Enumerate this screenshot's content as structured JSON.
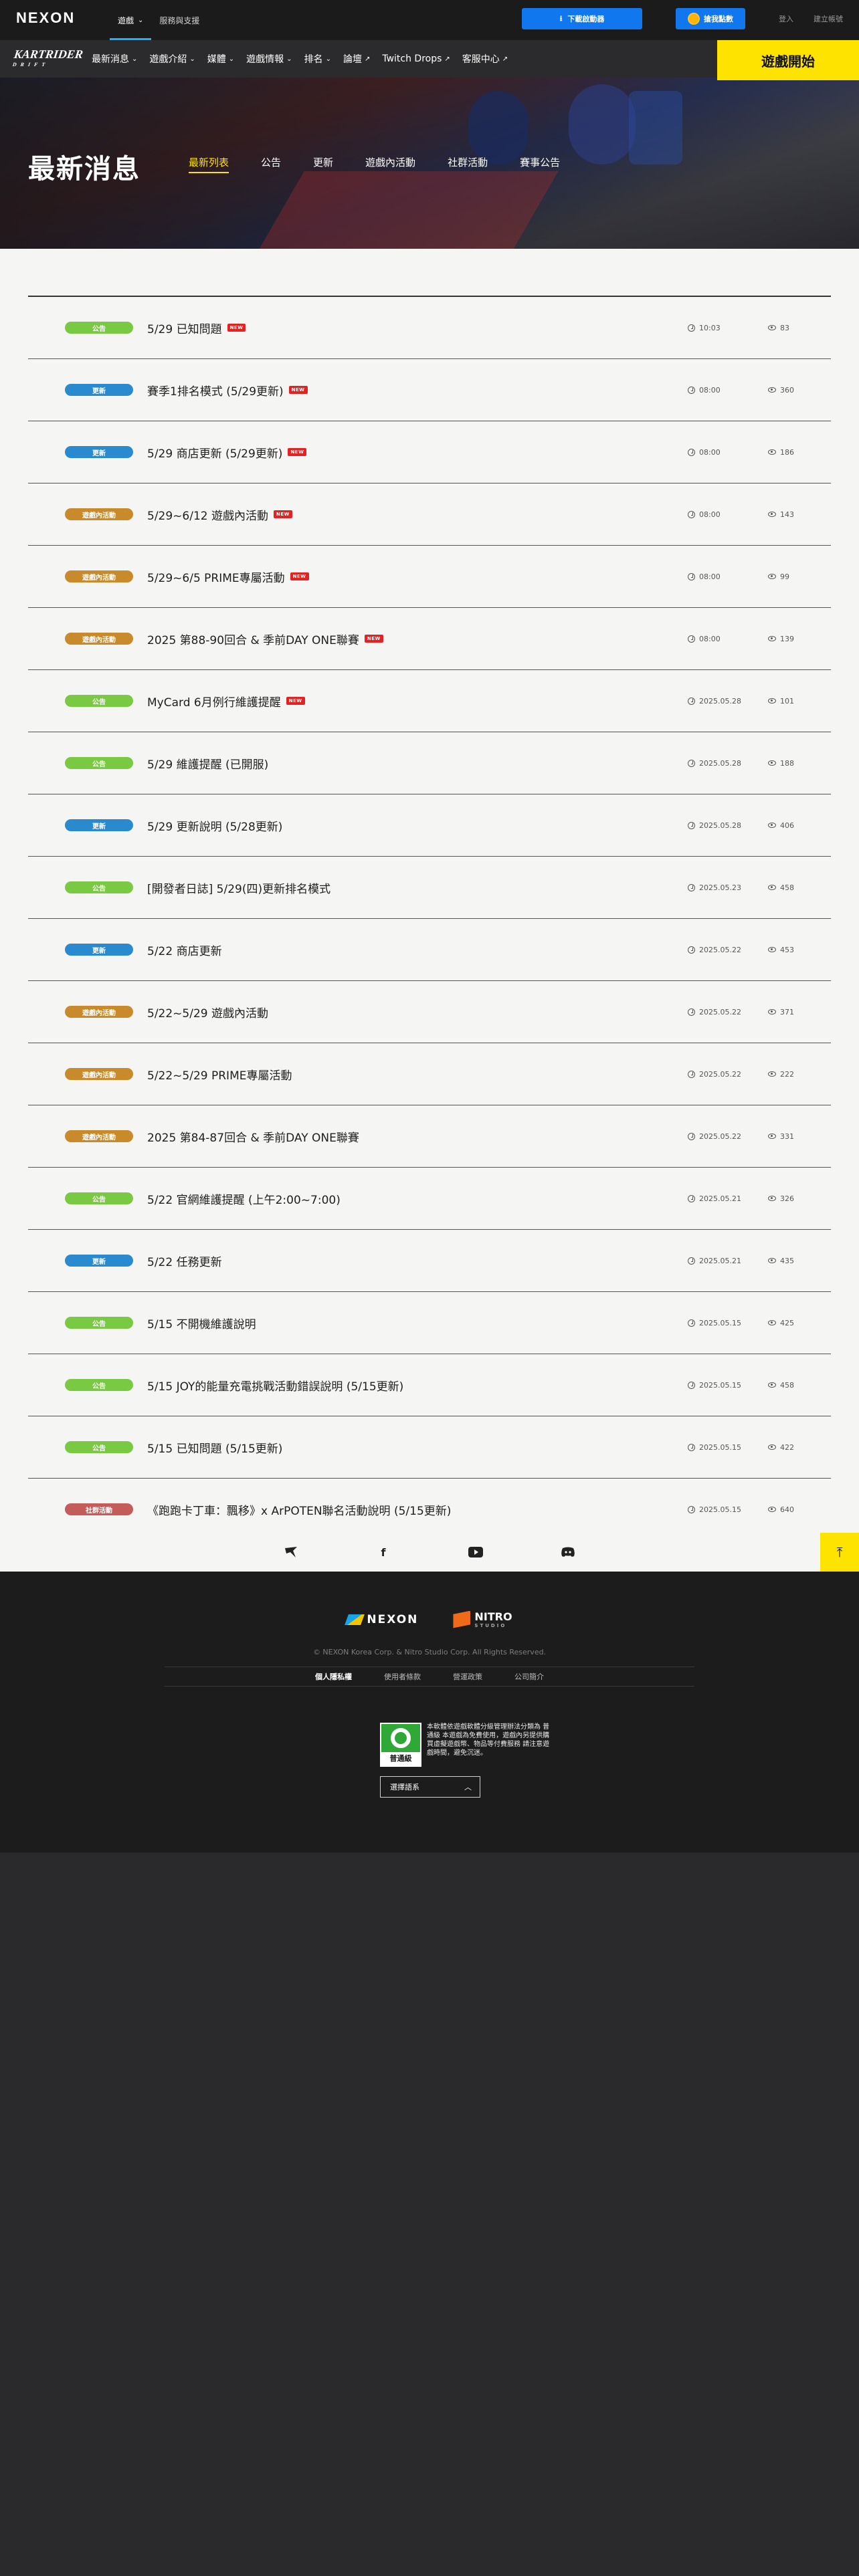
{
  "topbar": {
    "logo": "NEXON",
    "nav": [
      {
        "label": "遊戲",
        "caret": "⌄",
        "active": true
      },
      {
        "label": "服務與支援",
        "caret": "",
        "active": false
      }
    ],
    "download_label": "下載啟動器",
    "points_label": "搶我點數",
    "login_label": "登入",
    "register_label": "建立帳號"
  },
  "gamenav": {
    "logo": "KARTRIDER",
    "logo_sub": "DRIFT",
    "items": [
      {
        "label": "最新消息",
        "suffix": "⌄"
      },
      {
        "label": "遊戲介紹",
        "suffix": "⌄"
      },
      {
        "label": "媒體",
        "suffix": "⌄"
      },
      {
        "label": "遊戲情報",
        "suffix": "⌄"
      },
      {
        "label": "排名",
        "suffix": "⌄"
      },
      {
        "label": "論壇",
        "suffix": "↗"
      },
      {
        "label": "Twitch Drops",
        "suffix": "↗"
      },
      {
        "label": "客服中心",
        "suffix": "↗"
      }
    ],
    "start_label": "遊戲開始"
  },
  "banner": {
    "title": "最新消息",
    "tabs": [
      "最新列表",
      "公告",
      "更新",
      "遊戲內活動",
      "社群活動",
      "賽事公告"
    ],
    "active_tab": 0
  },
  "category_colors": {
    "公告": "#7ac943",
    "更新": "#2a8ad0",
    "遊戲內活動": "#c88a2a",
    "社群活動": "#c55c5c"
  },
  "news": [
    {
      "category": "公告",
      "title": "5/29 已知問題",
      "new": true,
      "date": "10:03",
      "views": "83"
    },
    {
      "category": "更新",
      "title": "賽季1排名模式 (5/29更新)",
      "new": true,
      "date": "08:00",
      "views": "360"
    },
    {
      "category": "更新",
      "title": "5/29 商店更新 (5/29更新)",
      "new": true,
      "date": "08:00",
      "views": "186"
    },
    {
      "category": "遊戲內活動",
      "title": "5/29~6/12 遊戲內活動",
      "new": true,
      "date": "08:00",
      "views": "143"
    },
    {
      "category": "遊戲內活動",
      "title": "5/29~6/5 PRIME專屬活動",
      "new": true,
      "date": "08:00",
      "views": "99"
    },
    {
      "category": "遊戲內活動",
      "title": "2025 第88-90回合 & 季前DAY ONE聯賽",
      "new": true,
      "date": "08:00",
      "views": "139"
    },
    {
      "category": "公告",
      "title": "MyCard 6月例行維護提醒",
      "new": true,
      "date": "2025.05.28",
      "views": "101"
    },
    {
      "category": "公告",
      "title": "5/29 維護提醒 (已開服)",
      "new": false,
      "date": "2025.05.28",
      "views": "188"
    },
    {
      "category": "更新",
      "title": "5/29 更新說明 (5/28更新)",
      "new": false,
      "date": "2025.05.28",
      "views": "406"
    },
    {
      "category": "公告",
      "title": "[開發者日誌] 5/29(四)更新排名模式",
      "new": false,
      "date": "2025.05.23",
      "views": "458"
    },
    {
      "category": "更新",
      "title": "5/22 商店更新",
      "new": false,
      "date": "2025.05.22",
      "views": "453"
    },
    {
      "category": "遊戲內活動",
      "title": "5/22~5/29 遊戲內活動",
      "new": false,
      "date": "2025.05.22",
      "views": "371"
    },
    {
      "category": "遊戲內活動",
      "title": "5/22~5/29 PRIME專屬活動",
      "new": false,
      "date": "2025.05.22",
      "views": "222"
    },
    {
      "category": "遊戲內活動",
      "title": "2025 第84-87回合 & 季前DAY ONE聯賽",
      "new": false,
      "date": "2025.05.22",
      "views": "331"
    },
    {
      "category": "公告",
      "title": "5/22 官網維護提醒 (上午2:00~7:00)",
      "new": false,
      "date": "2025.05.21",
      "views": "326"
    },
    {
      "category": "更新",
      "title": "5/22 任務更新",
      "new": false,
      "date": "2025.05.21",
      "views": "435"
    },
    {
      "category": "公告",
      "title": "5/15 不開機維護說明",
      "new": false,
      "date": "2025.05.15",
      "views": "425"
    },
    {
      "category": "公告",
      "title": "5/15 JOY的能量充電挑戰活動錯誤說明 (5/15更新)",
      "new": false,
      "date": "2025.05.15",
      "views": "458"
    },
    {
      "category": "公告",
      "title": "5/15 已知問題 (5/15更新)",
      "new": false,
      "date": "2025.05.15",
      "views": "422"
    },
    {
      "category": "社群活動",
      "title": "《跑跑卡丁車：飄移》x ArPOTEN聯名活動說明 (5/15更新)",
      "new": false,
      "date": "2025.05.15",
      "views": "640"
    }
  ],
  "new_tag": "NEW",
  "social": [
    "kart-icon",
    "facebook-icon",
    "youtube-icon",
    "discord-icon"
  ],
  "footer": {
    "nexon_logo": "NEXON",
    "nitro_logo": "NITRO",
    "nitro_sub": "STUDIO",
    "copyright": "© NEXON Korea Corp. & Nitro Studio Corp. All Rights Reserved.",
    "links": [
      {
        "label": "個人隱私權",
        "strong": true
      },
      {
        "label": "使用者條款",
        "strong": false
      },
      {
        "label": "營運政策",
        "strong": false
      },
      {
        "label": "公司簡介",
        "strong": false
      }
    ],
    "rating_label": "普通級",
    "rating_text": "本軟體依遊戲軟體分級管理辦法分類為 普通級 本遊戲為免費使用，遊戲內另提供購買虛擬遊戲幣、物品等付費服務 請注意遊戲時間，避免沉迷。",
    "language_label": "選擇語系"
  }
}
